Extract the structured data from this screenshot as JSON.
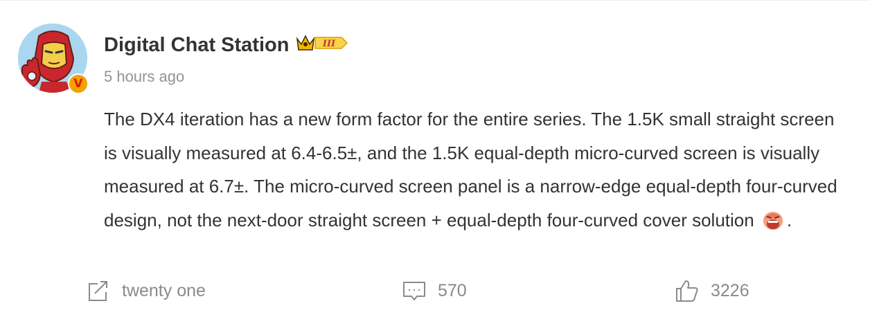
{
  "post": {
    "author": "Digital Chat Station",
    "rank_badge": "III",
    "time": "5 hours ago",
    "verified_badge": "V",
    "text_before_emoji": "The DX4 iteration has a new form factor for the entire series. The 1.5K small straight screen is visually measured at 6.4-6.5±, and the 1.5K equal-depth micro-curved screen is visually measured at 6.7±. The micro-curved screen panel is a narrow-edge equal-depth four-curved design, not the next-door straight screen + equal-depth four-curved cover solution",
    "text_after_emoji": "."
  },
  "actions": {
    "share_label": "twenty one",
    "comment_count": "570",
    "like_count": "3226"
  },
  "icons": {
    "share": "share-icon",
    "comment": "comment-icon",
    "like": "thumbs-up-icon",
    "emoji": "laughing-emoji-icon",
    "rank": "crown-rank-icon"
  },
  "colors": {
    "text": "#333333",
    "muted": "#8a8a8a",
    "timestamp": "#939393",
    "verified_badge": "#f5a100",
    "rank_badge": "#f7b500"
  }
}
